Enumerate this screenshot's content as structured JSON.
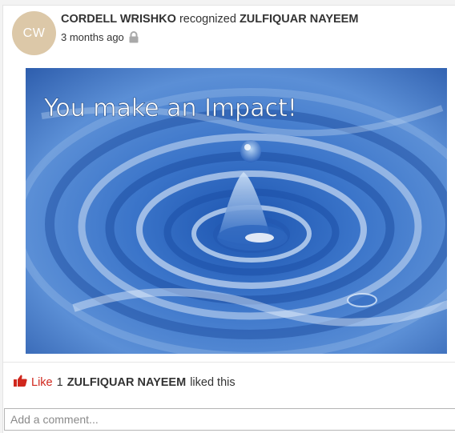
{
  "post": {
    "avatar_initials": "CW",
    "author": "CORDELL WRISHKO",
    "verb": "recognized",
    "recipient": "ZULFIQUAR NAYEEM",
    "timestamp": "3 months ago",
    "privacy_icon": "lock-icon",
    "image_caption": "You make an Impact!"
  },
  "likes": {
    "icon": "thumbs-up-icon",
    "like_label": "Like",
    "count": "1",
    "liker": "ZULFIQUAR NAYEEM",
    "suffix": "liked this"
  },
  "comment": {
    "placeholder": "Add a comment..."
  },
  "colors": {
    "avatar_bg": "#dcc8a8",
    "like_red": "#d0271d",
    "water_blue": "#2e63b8"
  }
}
